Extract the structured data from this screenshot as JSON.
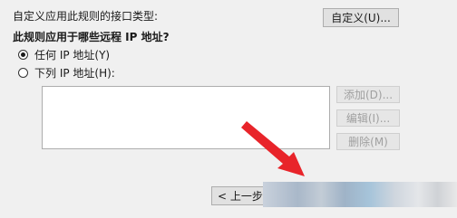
{
  "interface": {
    "label": "自定义应用此规则的接口类型:",
    "customize_label": "自定义(U)..."
  },
  "question": "此规则应用于哪些远程 IP 地址?",
  "options": {
    "any_ip_label": "任何 IP 地址(Y)",
    "listed_ip_label": "下列 IP 地址(H):",
    "selected": "any_ip"
  },
  "list_buttons": {
    "add_label": "添加(D)...",
    "edit_label": "编辑(I)...",
    "delete_label": "删除(M)"
  },
  "wizard": {
    "back_label": "< 上一步"
  },
  "colors": {
    "arrow": "#e8242a",
    "background": "#f0f0f0"
  }
}
